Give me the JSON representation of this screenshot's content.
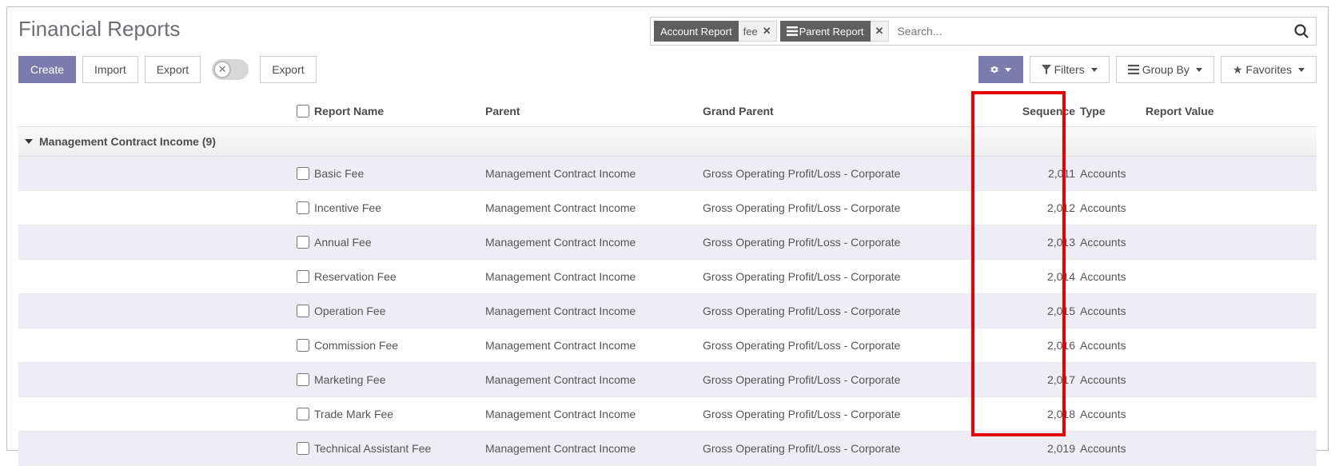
{
  "page_title": "Financial Reports",
  "search": {
    "facets": [
      {
        "label": "Account Report",
        "value": "fee"
      },
      {
        "label": "Parent Report",
        "value": "",
        "icon": "list"
      }
    ],
    "placeholder": "Search..."
  },
  "toolbar": {
    "create": "Create",
    "import": "Import",
    "export1": "Export",
    "export2": "Export",
    "filters": "Filters",
    "group_by": "Group By",
    "favorites": "Favorites"
  },
  "columns": {
    "report_name": "Report Name",
    "parent": "Parent",
    "grand_parent": "Grand Parent",
    "sequence": "Sequence",
    "type": "Type",
    "report_value": "Report Value"
  },
  "group": {
    "title": "Management Contract Income (9)"
  },
  "rows": [
    {
      "name": "Basic Fee",
      "parent": "Management Contract Income",
      "grand": "Gross Operating Profit/Loss - Corporate",
      "seq": "2,011",
      "type": "Accounts"
    },
    {
      "name": "Incentive Fee",
      "parent": "Management Contract Income",
      "grand": "Gross Operating Profit/Loss - Corporate",
      "seq": "2,012",
      "type": "Accounts"
    },
    {
      "name": "Annual Fee",
      "parent": "Management Contract Income",
      "grand": "Gross Operating Profit/Loss - Corporate",
      "seq": "2,013",
      "type": "Accounts"
    },
    {
      "name": "Reservation Fee",
      "parent": "Management Contract Income",
      "grand": "Gross Operating Profit/Loss - Corporate",
      "seq": "2,014",
      "type": "Accounts"
    },
    {
      "name": "Operation Fee",
      "parent": "Management Contract Income",
      "grand": "Gross Operating Profit/Loss - Corporate",
      "seq": "2,015",
      "type": "Accounts"
    },
    {
      "name": "Commission Fee",
      "parent": "Management Contract Income",
      "grand": "Gross Operating Profit/Loss - Corporate",
      "seq": "2,016",
      "type": "Accounts"
    },
    {
      "name": "Marketing Fee",
      "parent": "Management Contract Income",
      "grand": "Gross Operating Profit/Loss - Corporate",
      "seq": "2,017",
      "type": "Accounts"
    },
    {
      "name": "Trade Mark Fee",
      "parent": "Management Contract Income",
      "grand": "Gross Operating Profit/Loss - Corporate",
      "seq": "2,018",
      "type": "Accounts"
    },
    {
      "name": "Technical Assistant Fee",
      "parent": "Management Contract Income",
      "grand": "Gross Operating Profit/Loss - Corporate",
      "seq": "2,019",
      "type": "Accounts"
    }
  ]
}
